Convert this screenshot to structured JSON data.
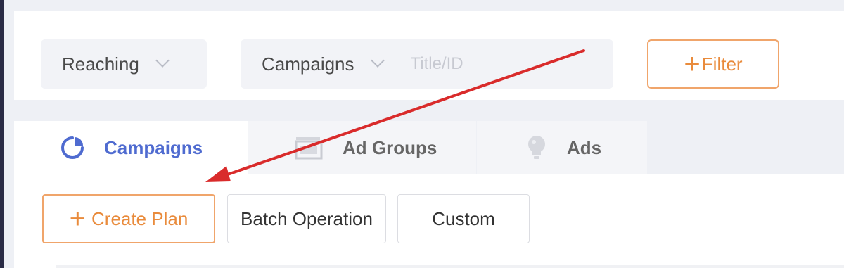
{
  "filters": {
    "reaching_label": "Reaching",
    "type_label": "Campaigns",
    "title_placeholder": "Title/ID",
    "filter_button_label": "Filter"
  },
  "tabs": [
    {
      "label": "Campaigns",
      "icon": "pie-chart-icon",
      "active": true
    },
    {
      "label": "Ad Groups",
      "icon": "image-gallery-icon",
      "active": false
    },
    {
      "label": "Ads",
      "icon": "lightbulb-icon",
      "active": false
    }
  ],
  "actions": {
    "create_plan_label": "Create Plan",
    "batch_operation_label": "Batch Operation",
    "custom_label": "Custom"
  },
  "colors": {
    "accent_orange": "#e98b3c",
    "active_tab_blue": "#4f6bd0",
    "annotation_arrow": "#d92b2b"
  }
}
